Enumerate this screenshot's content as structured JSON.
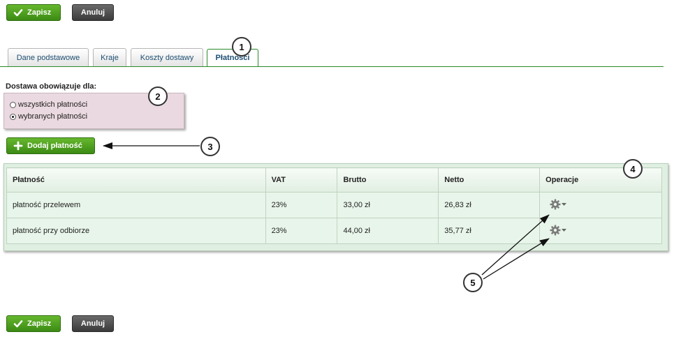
{
  "toolbar": {
    "save_label": "Zapisz",
    "cancel_label": "Anuluj"
  },
  "tabs": [
    {
      "label": "Dane podstawowe",
      "active": false
    },
    {
      "label": "Kraje",
      "active": false
    },
    {
      "label": "Koszty dostawy",
      "active": false
    },
    {
      "label": "Płatności",
      "active": true
    }
  ],
  "delivery": {
    "title": "Dostawa obowiązuje dla:",
    "options": [
      {
        "label": "wszystkich płatności",
        "checked": false
      },
      {
        "label": "wybranych płatności",
        "checked": true
      }
    ]
  },
  "add_payment_label": "Dodaj płatność",
  "table": {
    "headers": [
      "Płatność",
      "VAT",
      "Brutto",
      "Netto",
      "Operacje"
    ],
    "rows": [
      {
        "name": "płatność przelewem",
        "vat": "23%",
        "gross": "33,00 zł",
        "net": "26,83 zł"
      },
      {
        "name": "płatność przy odbiorze",
        "vat": "23%",
        "gross": "44,00 zł",
        "net": "35,77 zł"
      }
    ]
  },
  "callouts": [
    "1",
    "2",
    "3",
    "4",
    "5"
  ],
  "icons": {
    "save": "check-icon",
    "add": "plus-icon",
    "operations": "gear-icon",
    "dropdown": "caret-down-icon"
  },
  "colors": {
    "accent_green": "#4a9c1e",
    "tab_line": "#2a8a2a",
    "tab_text": "#1d4f73",
    "delivery_bg": "#ead9e0",
    "table_bg": "#dff0e2"
  }
}
